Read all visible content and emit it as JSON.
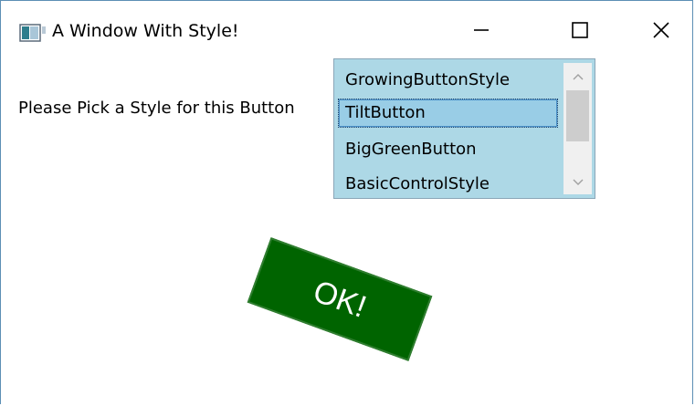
{
  "window": {
    "title": "A Window With Style!",
    "icon": "app-window-icon",
    "controls": {
      "minimize_icon": "minimize-icon",
      "maximize_icon": "maximize-icon",
      "close_icon": "close-icon"
    }
  },
  "main": {
    "prompt_label": "Please Pick a Style for this Button",
    "style_list": {
      "items": [
        "GrowingButtonStyle",
        "TiltButton",
        "BigGreenButton",
        "BasicControlStyle"
      ],
      "selected": "TiltButton",
      "background_color": "#add8e6",
      "scroll_up_icon": "chevron-up-icon",
      "scroll_down_icon": "chevron-down-icon"
    },
    "preview_button": {
      "label": "OK!",
      "background_color": "#006400",
      "text_color": "#ffffff",
      "rotation_degrees": 20
    }
  }
}
